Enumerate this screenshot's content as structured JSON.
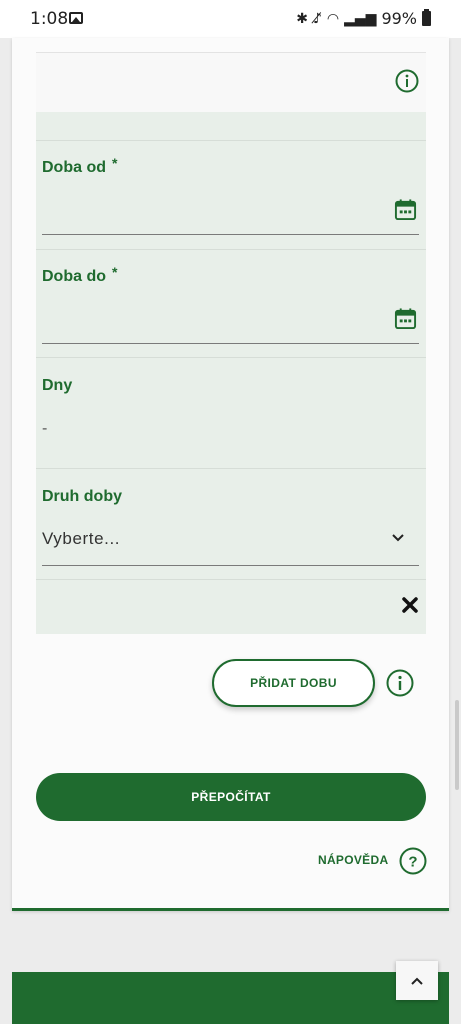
{
  "status_bar": {
    "time": "1:08",
    "battery": "99%",
    "icons": [
      "image-icon",
      "bluetooth-icon",
      "mute-icon",
      "wifi-icon",
      "signal-icon",
      "battery-icon"
    ]
  },
  "form": {
    "fields": [
      {
        "label": "Doba od",
        "required_mark": "*",
        "value": "",
        "icon": "calendar-icon"
      },
      {
        "label": "Doba do",
        "required_mark": "*",
        "value": "",
        "icon": "calendar-icon"
      },
      {
        "label": "Dny",
        "value": "-"
      },
      {
        "label": "Druh doby",
        "value": "Vyberte...",
        "icon": "chevron-down-icon"
      }
    ],
    "remove_icon": "close-icon",
    "add_period_label": "PŘIDAT DOBU",
    "recalculate_label": "PŘEPOČÍTAT",
    "help_label": "NÁPOVĚDA",
    "help_icon_glyph": "?"
  },
  "colors": {
    "accent": "#1f6b2f",
    "panel_bg": "#e8efe9",
    "page_bg": "#ececec"
  }
}
